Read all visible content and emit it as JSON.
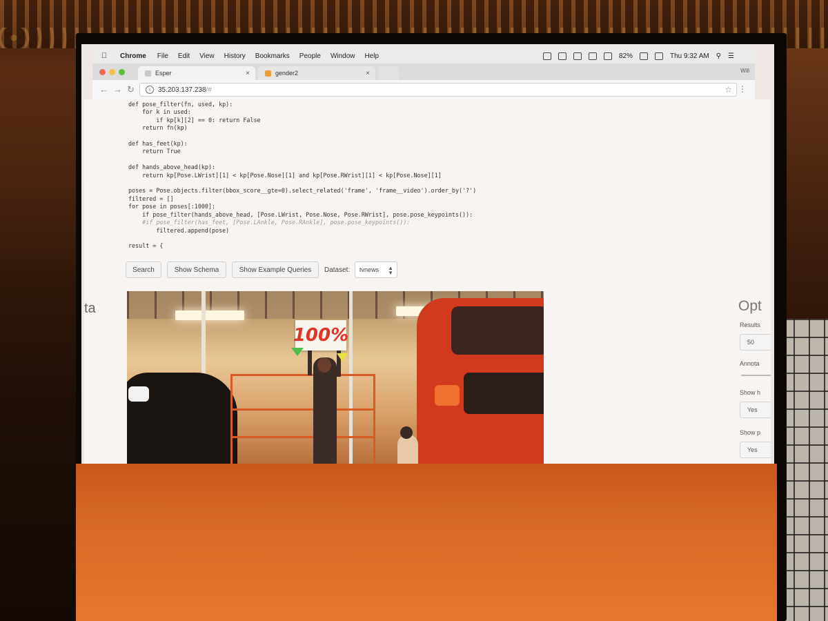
{
  "menubar": {
    "app_name": "Chrome",
    "items": [
      "File",
      "Edit",
      "View",
      "History",
      "Bookmarks",
      "People",
      "Window",
      "Help"
    ],
    "battery": "82%",
    "clock": "Thu 9:32 AM"
  },
  "tabs": [
    {
      "title": "Esper",
      "active": true
    },
    {
      "title": "gender2",
      "active": false
    }
  ],
  "profile": "Will",
  "address": {
    "host": "35.203.137.238",
    "path": "/#"
  },
  "code_lines": [
    "def pose_filter(fn, used, kp):",
    "    for k in used:",
    "        if kp[k][2] == 0: return False",
    "    return fn(kp)",
    "",
    "def has_feet(kp):",
    "    return True",
    "",
    "def hands_above_head(kp):",
    "    return kp[Pose.LWrist][1] < kp[Pose.Nose][1] and kp[Pose.RWrist][1] < kp[Pose.Nose][1]",
    "",
    "poses = Pose.objects.filter(bbox_score__gte=0).select_related('frame', 'frame__video').order_by('?')",
    "filtered = []",
    "for pose in poses[:1000]:",
    "    if pose_filter(hands_above_head, [Pose.LWrist, Pose.Nose, Pose.RWrist], pose.pose_keypoints()):",
    "    #if pose_filter(has_feet, [Pose.LAnkle, Pose.RAnkle], pose.pose_keypoints()):",
    "        filtered.append(pose)",
    "",
    "result = {"
  ],
  "buttons": {
    "search": "Search",
    "show_schema": "Show Schema",
    "show_examples": "Show Example Queries"
  },
  "dataset": {
    "label": "Dataset:",
    "selected": "tvnews"
  },
  "left_panel_title_fragment": "ta",
  "options": {
    "title_fragment": "Opt",
    "results_label": "Results",
    "results_value": "50",
    "annotation_label": "Annota",
    "show_hands_label": "Show h",
    "show_hands_value": "Yes",
    "show_pose_label": "Show p",
    "show_pose_value": "Yes"
  },
  "frame": {
    "sign_text": "100%"
  },
  "colors": {
    "keypoint_left_wrist": "#48c04a",
    "keypoint_right_wrist": "#e8e040",
    "projector_glow": "#e5772f"
  }
}
